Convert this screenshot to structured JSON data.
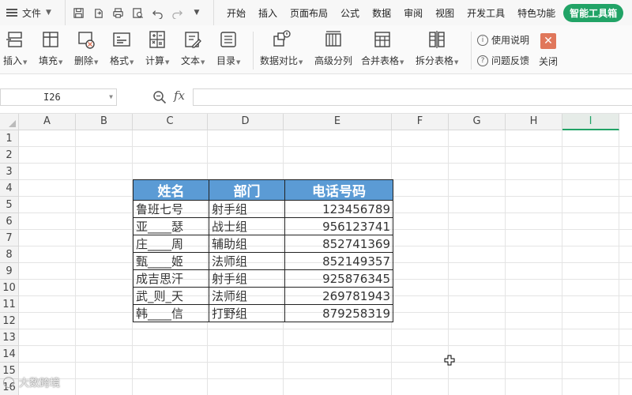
{
  "menubar": {
    "file_label": "文件",
    "tabs": [
      "开始",
      "插入",
      "页面布局",
      "公式",
      "数据",
      "审阅",
      "视图",
      "开发工具",
      "特色功能"
    ],
    "active_tab": "智能工具箱"
  },
  "ribbon": {
    "buttons": [
      "插入",
      "填充",
      "删除",
      "格式",
      "计算",
      "文本",
      "目录",
      "数据对比",
      "高级分列",
      "合并表格",
      "拆分表格"
    ],
    "help_label": "使用说明",
    "feedback_label": "问题反馈",
    "close_label": "关闭"
  },
  "formula_bar": {
    "cell_ref": "I26",
    "fx_label": "fx",
    "value": ""
  },
  "grid": {
    "columns": [
      "A",
      "B",
      "C",
      "D",
      "E",
      "F",
      "G",
      "H",
      "I"
    ],
    "selected_column": "I",
    "rows": [
      "1",
      "2",
      "3",
      "4",
      "5",
      "6",
      "7",
      "8",
      "9",
      "10",
      "11",
      "12",
      "13",
      "14",
      "15",
      "16"
    ]
  },
  "table": {
    "headers": [
      "姓名",
      "部门",
      "电话号码"
    ],
    "rows": [
      [
        "鲁班七号",
        "射手组",
        "123456789"
      ],
      [
        "亚____瑟",
        "战士组",
        "956123741"
      ],
      [
        "庄____周",
        "辅助组",
        "852741369"
      ],
      [
        "甄____姬",
        "法师组",
        "852149357"
      ],
      [
        "成吉思汗",
        "射手组",
        "925876345"
      ],
      [
        "武_则_天",
        "法师组",
        "269781943"
      ],
      [
        "韩____信",
        "打野组",
        "879258319"
      ]
    ]
  },
  "colors": {
    "accent": "#21a366",
    "header_fill": "#5b9bd5",
    "close_button": "#e0775b"
  },
  "watermark": "大数跨境"
}
